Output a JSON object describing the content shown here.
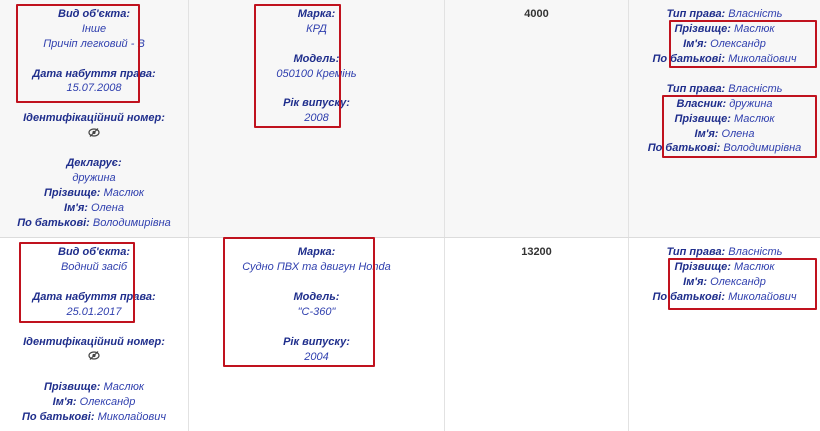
{
  "labels": {
    "object_type": "Вид об'єкта:",
    "acquired": "Дата набуття права:",
    "ident": "Ідентифікаційний номер:",
    "declares": "Декларує:",
    "surname": "Прізвище:",
    "name": "Ім'я:",
    "patronymic": "По батькові:",
    "brand": "Марка:",
    "model": "Модель:",
    "year": "Рік випуску:",
    "right_type": "Тип права:",
    "owner": "Власник:"
  },
  "row1": {
    "object_type": "Інше",
    "object_subtype": "Причіп легковий - В",
    "acquired": "15.07.2008",
    "declares": "дружина",
    "surname": "Маслюк",
    "name": "Олена",
    "patronymic": "Володимирівна",
    "brand": "КРД",
    "model": "050100 Кремінь",
    "year": "2008",
    "cost": "4000",
    "owners": [
      {
        "right_type": "Власність",
        "surname": "Маслюк",
        "name": "Олександр",
        "patronymic": "Миколайович"
      },
      {
        "right_type": "Власність",
        "owner": "дружина",
        "surname": "Маслюк",
        "name": "Олена",
        "patronymic": "Володимирівна"
      }
    ]
  },
  "row2": {
    "object_type": "Водний засіб",
    "acquired": "25.01.2017",
    "surname": "Маслюк",
    "name": "Олександр",
    "patronymic": "Миколайович",
    "brand": "Судно ПВХ та двигун Honda",
    "model": "\"С-360\"",
    "year": "2004",
    "cost": "13200",
    "owners": [
      {
        "right_type": "Власність",
        "surname": "Маслюк",
        "name": "Олександр",
        "patronymic": "Миколайович"
      }
    ]
  },
  "colors": {
    "highlight_border": "#c0121e",
    "label": "#1f2e8c",
    "value": "#2f3fae"
  },
  "icons": {
    "hidden": "eye-slash-icon"
  }
}
